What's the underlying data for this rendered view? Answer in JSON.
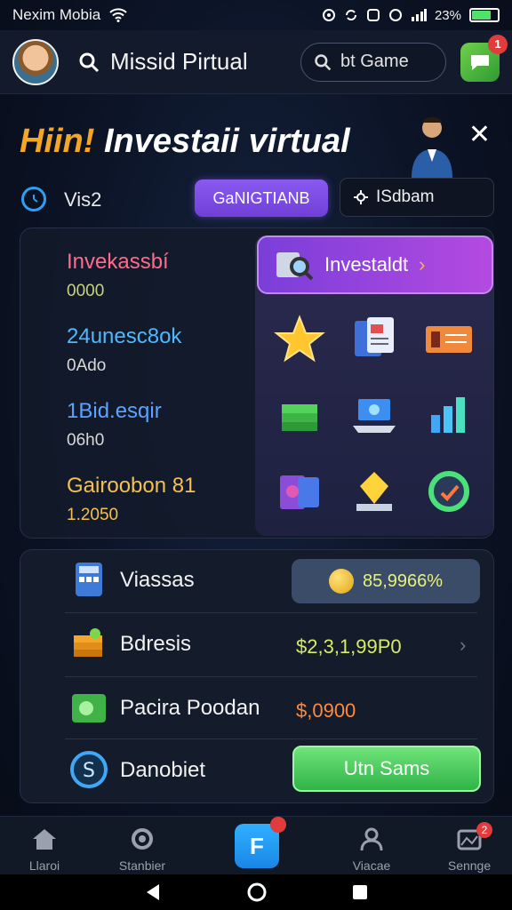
{
  "status_bar": {
    "carrier": "Nexim Mobia",
    "battery_text": "23%"
  },
  "top_bar": {
    "title": "Missid Pirtual",
    "search_placeholder": "bt Game",
    "notification_count": "1"
  },
  "hero": {
    "title_accent": "Hiin!",
    "title_rest": " Investaii virtual"
  },
  "tabs": {
    "left_label": "Vis2",
    "purple_tab": "GaNIGTIANB",
    "dark_tab": "ISdbam"
  },
  "stats": [
    {
      "name": "Invekassbí",
      "value": "0000"
    },
    {
      "name": "24unesc8ok",
      "value": "0Ado"
    },
    {
      "name": "1Bid.esqir",
      "value": "06h0"
    },
    {
      "name": "Gairoobon 81",
      "value": "1.2050"
    }
  ],
  "grid": {
    "button_label": "Investaldt"
  },
  "list": [
    {
      "label": "Viassas",
      "value": "85,9966%"
    },
    {
      "label": "Bdresis",
      "value": "$2,3,1,99P0"
    },
    {
      "label": "Pacira Poodan",
      "value": "$,0900"
    },
    {
      "label": "Danobiet",
      "value": "Utn Sams"
    }
  ],
  "nav": {
    "items": [
      "Llaroi",
      "Stanbier",
      "F",
      "Viacae",
      "Sennge"
    ],
    "settings_badge": "2"
  },
  "colors": {
    "accent_orange": "#f5a623",
    "purple": "#7a3ed9",
    "green": "#2fb347",
    "blue": "#1a86e6"
  }
}
